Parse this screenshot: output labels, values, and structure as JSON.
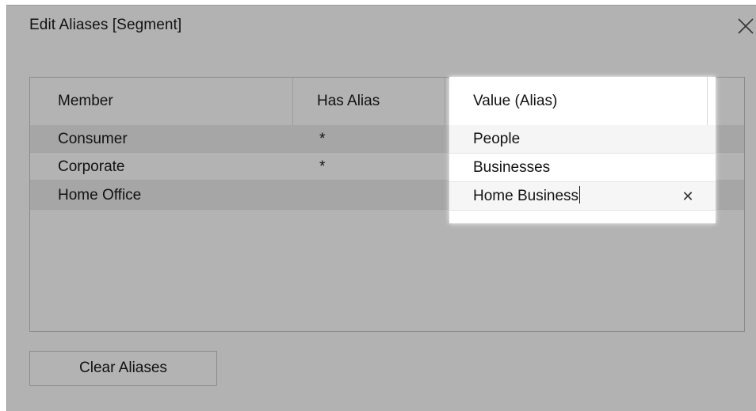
{
  "dialog": {
    "title": "Edit Aliases [Segment]",
    "close_icon": "close-icon"
  },
  "table": {
    "columns": {
      "member": "Member",
      "has_alias": "Has Alias",
      "value": "Value (Alias)"
    },
    "rows": [
      {
        "member": "Consumer",
        "has_alias": "*",
        "value": "People"
      },
      {
        "member": "Corporate",
        "has_alias": "*",
        "value": "Businesses"
      },
      {
        "member": "Home Office",
        "has_alias": "",
        "value": "Home Business"
      }
    ],
    "editing_row_clear_icon": "clear-text-icon"
  },
  "buttons": {
    "clear_aliases": "Clear Aliases"
  },
  "colors": {
    "dialog_background": "#b2b2b2",
    "highlight": "#ffffff"
  }
}
